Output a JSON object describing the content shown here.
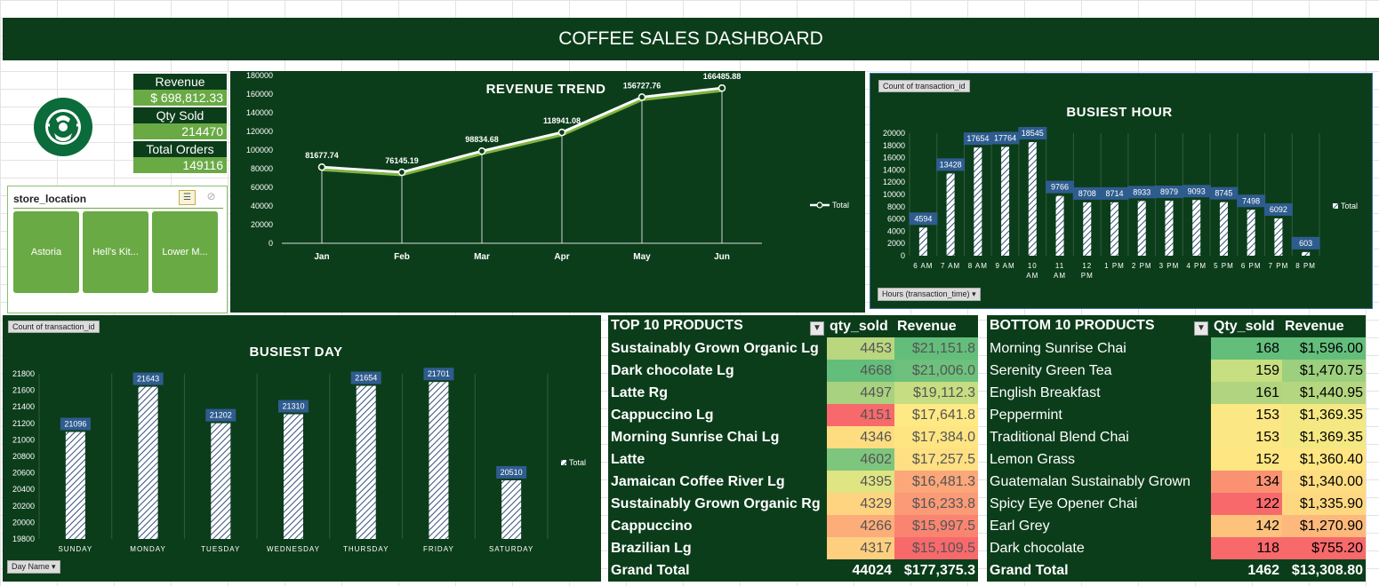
{
  "title": "COFFEE SALES DASHBOARD",
  "kpis": {
    "revenue_label": "Revenue",
    "revenue_value": "$ 698,812.33",
    "qty_label": "Qty Sold",
    "qty_value": "214470",
    "orders_label": "Total Orders",
    "orders_value": "149116"
  },
  "slicer": {
    "title": "store_location",
    "items": [
      "Astoria",
      "Hell's Kit...",
      "Lower M..."
    ]
  },
  "chart_data": [
    {
      "type": "line",
      "title": "REVENUE TREND",
      "categories": [
        "Jan",
        "Feb",
        "Mar",
        "Apr",
        "May",
        "Jun"
      ],
      "series": [
        {
          "name": "Total",
          "values": [
            81677.74,
            76145.19,
            98834.68,
            118941.08,
            156727.76,
            166485.88
          ]
        }
      ],
      "ylim": [
        0,
        180000
      ],
      "yticks": [
        "180000",
        "160000",
        "140000",
        "120000",
        "100000",
        "80000",
        "60000",
        "40000",
        "20000",
        "0"
      ],
      "legend": "right",
      "line_color": "#ffffff"
    },
    {
      "type": "bar",
      "title": "BUSIEST HOUR",
      "pivot_field": "Count of transaction_id",
      "axis_field": "Hours (transaction_time)",
      "categories": [
        "6 AM",
        "7 AM",
        "8 AM",
        "9 AM",
        "10 AM",
        "11 AM",
        "12 PM",
        "1 PM",
        "2 PM",
        "3 PM",
        "4 PM",
        "5 PM",
        "6 PM",
        "7 PM",
        "8 PM"
      ],
      "series": [
        {
          "name": "Total",
          "values": [
            4594,
            13428,
            17654,
            17764,
            18545,
            9766,
            8708,
            8714,
            8933,
            8979,
            9093,
            8745,
            7498,
            6092,
            603
          ]
        }
      ],
      "ylim": [
        0,
        20000
      ],
      "yticks": [
        "20000",
        "18000",
        "16000",
        "14000",
        "12000",
        "10000",
        "8000",
        "6000",
        "4000",
        "2000",
        "0"
      ],
      "legend": "right",
      "label_color": "#2f5c8f"
    },
    {
      "type": "bar",
      "title": "BUSIEST DAY",
      "pivot_field": "Count of transaction_id",
      "axis_field": "Day Name",
      "categories": [
        "SUNDAY",
        "MONDAY",
        "TUESDAY",
        "WEDNESDAY",
        "THURSDAY",
        "FRIDAY",
        "SATURDAY"
      ],
      "series": [
        {
          "name": "Total",
          "values": [
            21096,
            21643,
            21202,
            21310,
            21654,
            21701,
            20510
          ]
        }
      ],
      "ylim": [
        19800,
        21800
      ],
      "yticks": [
        "21800",
        "21600",
        "21400",
        "21200",
        "21000",
        "20800",
        "20600",
        "20400",
        "20200",
        "20000",
        "19800"
      ],
      "legend": "right",
      "label_color": "#2f5c8f"
    }
  ],
  "top_products": {
    "header_name": "TOP 10 PRODUCTS",
    "header_qty": "qty_sold",
    "header_rev": "Revenue",
    "rows": [
      {
        "name": "Sustainably Grown Organic Lg",
        "qty": "4453",
        "rev": "$21,151.8",
        "qty_color": "#b9d77f",
        "rev_color": "#63be7b"
      },
      {
        "name": "Dark chocolate Lg",
        "qty": "4668",
        "rev": "$21,006.0",
        "qty_color": "#63be7b",
        "rev_color": "#6dc17c"
      },
      {
        "name": "Latte Rg",
        "qty": "4497",
        "rev": "$19,112.3",
        "qty_color": "#a8d27f",
        "rev_color": "#c6de81"
      },
      {
        "name": "Cappuccino Lg",
        "qty": "4151",
        "rev": "$17,641.8",
        "qty_color": "#f8696b",
        "rev_color": "#fee984"
      },
      {
        "name": "Morning Sunrise Chai Lg",
        "qty": "4346",
        "rev": "$17,384.0",
        "qty_color": "#fedd81",
        "rev_color": "#fee582"
      },
      {
        "name": "Latte",
        "qty": "4602",
        "rev": "$17,257.5",
        "qty_color": "#7ec57d",
        "rev_color": "#fee082"
      },
      {
        "name": "Jamaican Coffee River Lg",
        "qty": "4395",
        "rev": "$16,481.3",
        "qty_color": "#e0e583",
        "rev_color": "#fba77a"
      },
      {
        "name": "Sustainably Grown Organic Rg",
        "qty": "4329",
        "rev": "$16,233.8",
        "qty_color": "#fed480",
        "rev_color": "#fa9a77"
      },
      {
        "name": "Cappuccino",
        "qty": "4266",
        "rev": "$15,997.5",
        "qty_color": "#fcad79",
        "rev_color": "#f98571"
      },
      {
        "name": "Brazilian Lg",
        "qty": "4317",
        "rev": "$15,109.5",
        "qty_color": "#fecf7f",
        "rev_color": "#f8696b"
      }
    ],
    "total_label": "Grand Total",
    "total_qty": "44024",
    "total_rev": "$177,375.3"
  },
  "bottom_products": {
    "header_name": "BOTTOM 10 PRODUCTS",
    "header_qty": "Qty_sold",
    "header_rev": "Revenue",
    "rows": [
      {
        "name": "Morning Sunrise Chai",
        "qty": "168",
        "rev": "$1,596.00",
        "qty_color": "#63be7b",
        "rev_color": "#63be7b"
      },
      {
        "name": "Serenity Green Tea",
        "qty": "159",
        "rev": "$1,470.75",
        "qty_color": "#c7df81",
        "rev_color": "#9ccf7e"
      },
      {
        "name": "English Breakfast",
        "qty": "161",
        "rev": "$1,440.95",
        "qty_color": "#b0d47f",
        "rev_color": "#b5d680"
      },
      {
        "name": "Peppermint",
        "qty": "153",
        "rev": "$1,369.35",
        "qty_color": "#fbe783",
        "rev_color": "#f4e883"
      },
      {
        "name": "Traditional Blend Chai",
        "qty": "153",
        "rev": "$1,369.35",
        "qty_color": "#fbe783",
        "rev_color": "#f4e883"
      },
      {
        "name": "Lemon Grass",
        "qty": "152",
        "rev": "$1,360.40",
        "qty_color": "#fee683",
        "rev_color": "#fee683"
      },
      {
        "name": "Guatemalan Sustainably Grown",
        "qty": "134",
        "rev": "$1,340.00",
        "qty_color": "#fa9272",
        "rev_color": "#fedc81"
      },
      {
        "name": "Spicy Eye Opener Chai",
        "qty": "122",
        "rev": "$1,335.90",
        "qty_color": "#f8696b",
        "rev_color": "#fed880"
      },
      {
        "name": "Earl Grey",
        "qty": "142",
        "rev": "$1,270.90",
        "qty_color": "#fdc37d",
        "rev_color": "#fcb97b"
      },
      {
        "name": "Dark chocolate",
        "qty": "118",
        "rev": "$755.20",
        "qty_color": "#f8696b",
        "rev_color": "#f8696b"
      }
    ],
    "total_label": "Grand Total",
    "total_qty": "1462",
    "total_rev": "$13,308.80"
  }
}
